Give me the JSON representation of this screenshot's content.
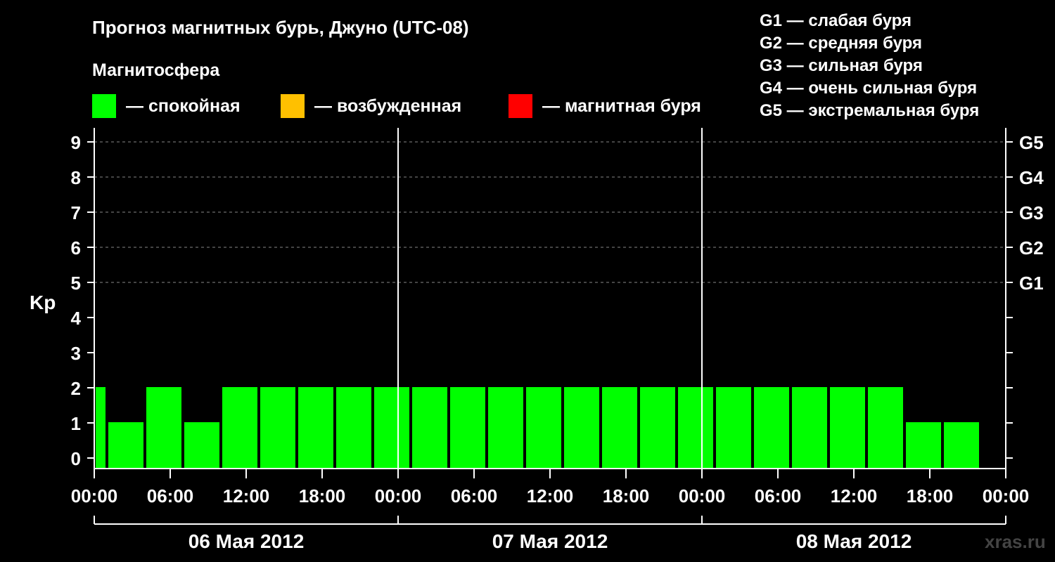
{
  "title": "Прогноз магнитных бурь, Джуно (UTC-08)",
  "magnetosphere": {
    "title": "Магнитосфера",
    "legend": [
      {
        "color": "#00ff00",
        "label": "— спокойная"
      },
      {
        "color": "#ffc000",
        "label": "— возбужденная"
      },
      {
        "color": "#ff0000",
        "label": "— магнитная буря"
      }
    ]
  },
  "g_legend": [
    "G1 — слабая буря",
    "G2 — средняя буря",
    "G3 — сильная буря",
    "G4 — очень сильная буря",
    "G5 — экстремальная буря"
  ],
  "watermark": "xras.ru",
  "chart_data": {
    "type": "bar",
    "ylabel": "Kp",
    "ylim": [
      0,
      9
    ],
    "yticks": [
      0,
      1,
      2,
      3,
      4,
      5,
      6,
      7,
      8,
      9
    ],
    "y2_labels": [
      {
        "value": 5,
        "label": "G1"
      },
      {
        "value": 6,
        "label": "G2"
      },
      {
        "value": 7,
        "label": "G3"
      },
      {
        "value": 8,
        "label": "G4"
      },
      {
        "value": 9,
        "label": "G5"
      }
    ],
    "x_range_hours": [
      0,
      72
    ],
    "x_tick_labels": [
      "00:00",
      "06:00",
      "12:00",
      "18:00",
      "00:00",
      "06:00",
      "12:00",
      "18:00",
      "00:00",
      "06:00",
      "12:00",
      "18:00",
      "00:00"
    ],
    "days": [
      "06 Мая 2012",
      "07 Мая 2012",
      "08 Мая 2012"
    ],
    "bar_color": "#00ff00",
    "bars": [
      {
        "start": 0,
        "end": 1,
        "kp": 2
      },
      {
        "start": 1,
        "end": 4,
        "kp": 1
      },
      {
        "start": 4,
        "end": 7,
        "kp": 2
      },
      {
        "start": 7,
        "end": 10,
        "kp": 1
      },
      {
        "start": 10,
        "end": 13,
        "kp": 2
      },
      {
        "start": 13,
        "end": 16,
        "kp": 2
      },
      {
        "start": 16,
        "end": 19,
        "kp": 2
      },
      {
        "start": 19,
        "end": 22,
        "kp": 2
      },
      {
        "start": 22,
        "end": 25,
        "kp": 2
      },
      {
        "start": 25,
        "end": 28,
        "kp": 2
      },
      {
        "start": 28,
        "end": 31,
        "kp": 2
      },
      {
        "start": 31,
        "end": 34,
        "kp": 2
      },
      {
        "start": 34,
        "end": 37,
        "kp": 2
      },
      {
        "start": 37,
        "end": 40,
        "kp": 2
      },
      {
        "start": 40,
        "end": 43,
        "kp": 2
      },
      {
        "start": 43,
        "end": 46,
        "kp": 2
      },
      {
        "start": 46,
        "end": 49,
        "kp": 2
      },
      {
        "start": 49,
        "end": 52,
        "kp": 2
      },
      {
        "start": 52,
        "end": 55,
        "kp": 2
      },
      {
        "start": 55,
        "end": 58,
        "kp": 2
      },
      {
        "start": 58,
        "end": 61,
        "kp": 2
      },
      {
        "start": 61,
        "end": 64,
        "kp": 2
      },
      {
        "start": 64,
        "end": 67,
        "kp": 1
      },
      {
        "start": 67,
        "end": 70,
        "kp": 1
      }
    ]
  }
}
